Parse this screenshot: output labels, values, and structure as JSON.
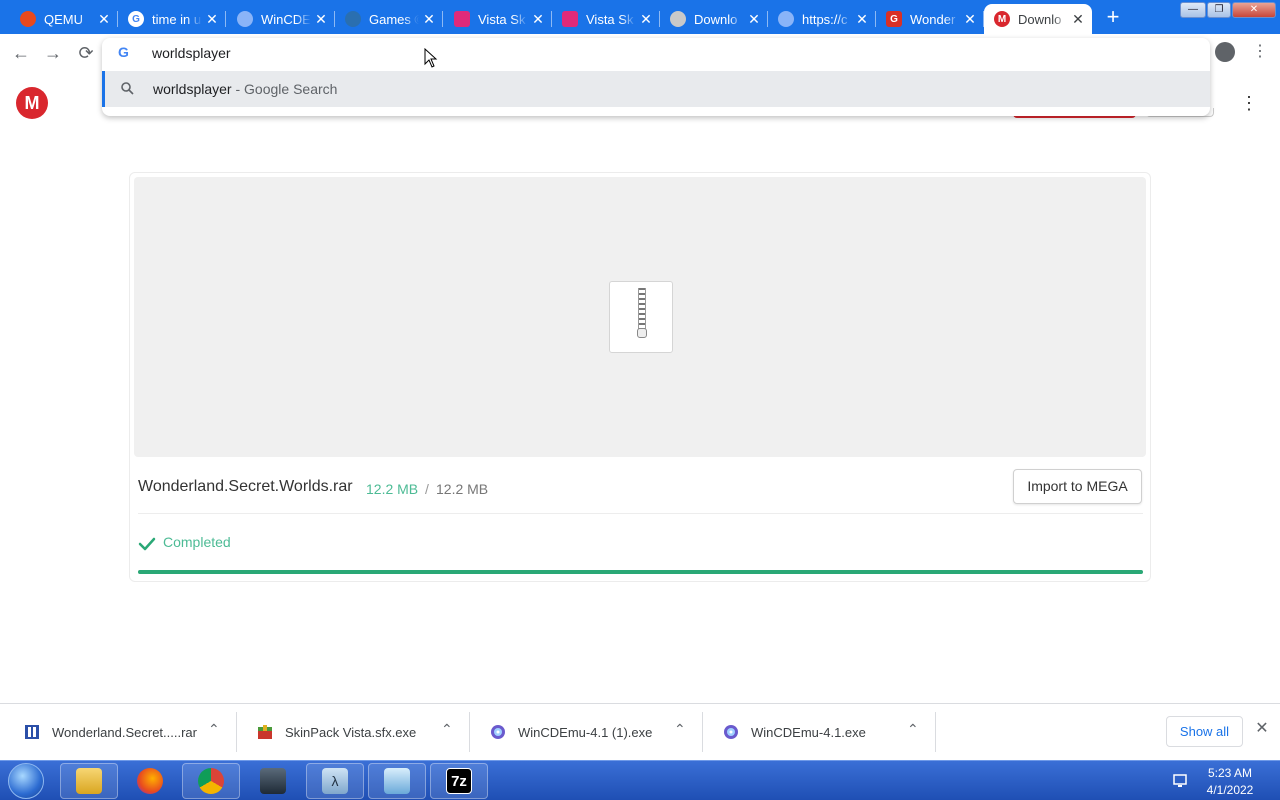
{
  "browser": {
    "tabs": [
      {
        "title": "QEMU",
        "favicon": "qemu-icon",
        "color": "#e8491d"
      },
      {
        "title": "time in u",
        "favicon": "google-icon",
        "color": "#4285f4"
      },
      {
        "title": "WinCDEm",
        "favicon": "globe-icon",
        "color": "#8ab4f8"
      },
      {
        "title": "Games ©",
        "favicon": "games-icon",
        "color": "#2a6fb0"
      },
      {
        "title": "Vista Sk",
        "favicon": "skinpack-icon",
        "color": "#e02a7a"
      },
      {
        "title": "Vista Sk",
        "favicon": "skinpack-icon",
        "color": "#e02a7a"
      },
      {
        "title": "Downlo",
        "favicon": "download-site-icon",
        "color": "#c9c9c9"
      },
      {
        "title": "https://c",
        "favicon": "globe-icon",
        "color": "#8ab4f8"
      },
      {
        "title": "Wonder",
        "favicon": "g-red-icon",
        "color": "#d93025"
      },
      {
        "title": "Downlo",
        "favicon": "mega-icon",
        "color": "#d9272e"
      }
    ],
    "tab_close_glyph": "✕",
    "new_tab_glyph": "+",
    "omnibox": {
      "text": "worldsplayer",
      "suggestion_query": "worldsplayer",
      "suggestion_desc": " - Google Search"
    }
  },
  "page": {
    "logo_letter": "M",
    "file_name": "Wonderland.Secret.Worlds.rar",
    "size_done": "12.2 MB",
    "size_sep": "/",
    "size_total": "12.2 MB",
    "import_label": "Import to MEGA",
    "status": "Completed",
    "progress": 1.0,
    "accent": "#2aa876"
  },
  "downloads": {
    "items": [
      {
        "name": "Wonderland.Secret.....rar",
        "icon": "archive-icon"
      },
      {
        "name": "SkinPack Vista.sfx.exe",
        "icon": "installer-icon"
      },
      {
        "name": "WinCDEmu-4.1 (1).exe",
        "icon": "wincdemu-icon"
      },
      {
        "name": "WinCDEmu-4.1.exe",
        "icon": "wincdemu-icon"
      }
    ],
    "caret": "⌃",
    "show_all": "Show all",
    "close": "✕"
  },
  "taskbar": {
    "apps": [
      "file-explorer-icon",
      "firefox-icon",
      "chrome-icon",
      "vm-icon",
      "lambda-app-icon",
      "control-panel-icon",
      "7zip-icon"
    ],
    "app_badge_7z": "7z",
    "time": "5:23 AM",
    "date": "4/1/2022"
  }
}
